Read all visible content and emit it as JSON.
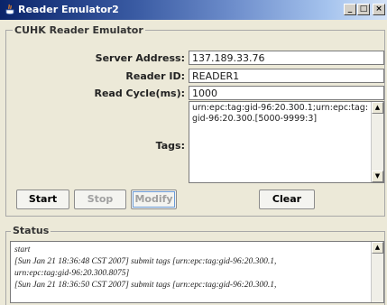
{
  "window": {
    "title": "Reader Emulator2",
    "minimize_glyph": "_",
    "maximize_glyph": "□",
    "close_glyph": "×"
  },
  "reader_group": {
    "legend": "CUHK Reader Emulator",
    "server_address": {
      "label": "Server Address:",
      "value": "137.189.33.76"
    },
    "reader_id": {
      "label": "Reader ID:",
      "value": "READER1"
    },
    "read_cycle": {
      "label": "Read Cycle(ms):",
      "value": "1000"
    },
    "tags": {
      "label": "Tags:",
      "value": "urn:epc:tag:gid-96:20.300.1;urn:epc:tag:gid-96:20.300.[5000-9999:3]"
    }
  },
  "buttons": {
    "start": "Start",
    "stop": "Stop",
    "modify": "Modify",
    "clear": "Clear"
  },
  "status_group": {
    "legend": "Status",
    "lines": [
      "start",
      "[Sun Jan 21 18:36:48 CST 2007] submit tags [urn:epc:tag:gid-96:20.300.1,",
      "urn:epc:tag:gid-96:20.300.8075]",
      "[Sun Jan 21 18:36:50 CST 2007] submit tags [urn:epc:tag:gid-96:20.300.1,"
    ]
  },
  "scroll_glyphs": {
    "up": "▲",
    "down": "▼"
  }
}
